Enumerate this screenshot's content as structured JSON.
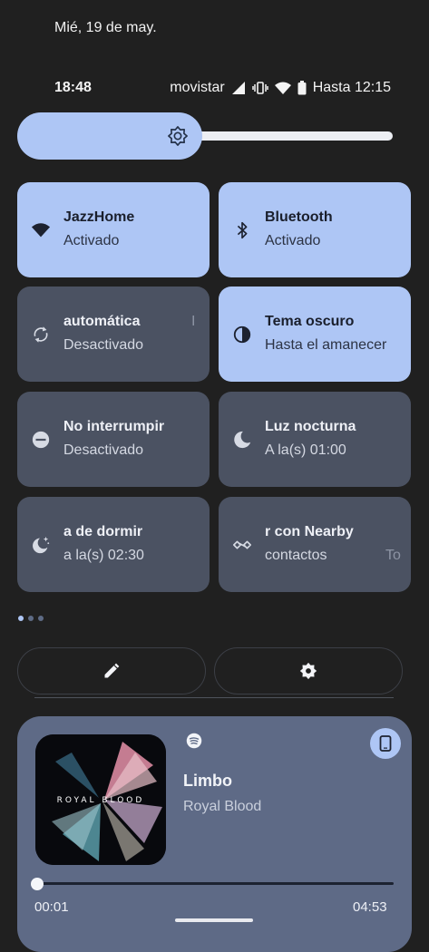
{
  "lock_date": "Mié, 19 de may.",
  "status_bar": {
    "time": "18:48",
    "carrier": "movistar",
    "battery_text": "Hasta 12:15"
  },
  "brightness": {
    "level": 0.42
  },
  "tiles": [
    {
      "title": "JazzHome",
      "subtitle": "Activado",
      "state": "on",
      "icon": "wifi-icon"
    },
    {
      "title": "Bluetooth",
      "subtitle": "Activado",
      "state": "on",
      "icon": "bluetooth-icon"
    },
    {
      "title": "automática",
      "subtitle": "Desactivado",
      "state": "off",
      "icon": "auto-rotate-icon",
      "overflow": "I"
    },
    {
      "title": "Tema oscuro",
      "subtitle": "Hasta el amanecer",
      "state": "on",
      "icon": "dark-theme-icon"
    },
    {
      "title": "No interrumpir",
      "subtitle": "Desactivado",
      "state": "off",
      "icon": "do-not-disturb-icon"
    },
    {
      "title": "Luz nocturna",
      "subtitle": "A la(s) 01:00",
      "state": "off",
      "icon": "night-light-icon"
    },
    {
      "title": "a de dormir",
      "subtitle": "a la(s) 02:30",
      "state": "off",
      "icon": "bedtime-icon"
    },
    {
      "title": "r con Nearby",
      "subtitle": "contactos",
      "state": "off",
      "icon": "nearby-share-icon",
      "overflow": "To"
    }
  ],
  "pager": {
    "pages": 3,
    "current": 1
  },
  "media": {
    "song": "Limbo",
    "artist": "Royal Blood",
    "album_text": "ROYAL BLOOD",
    "elapsed": "00:01",
    "total": "04:53",
    "progress": 0.003,
    "app_icon": "spotify-icon",
    "output_icon": "phone-icon"
  },
  "colors": {
    "background": "#202020",
    "tile_on": "#aec6f5",
    "tile_off": "#4b5262",
    "media_card": "#5e6a86"
  }
}
